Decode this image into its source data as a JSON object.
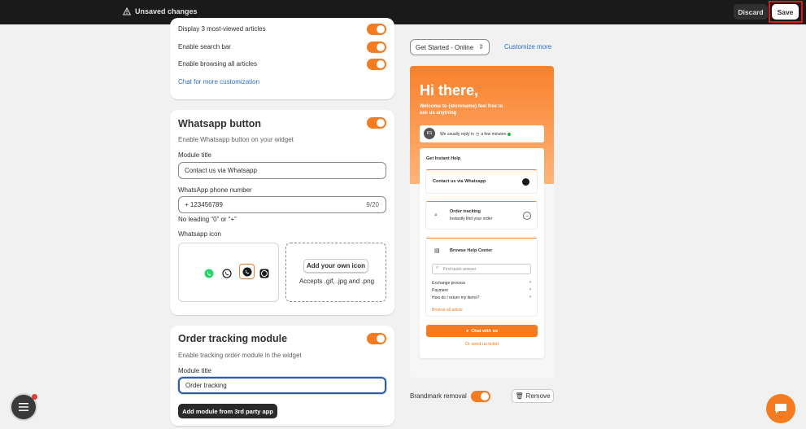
{
  "topbar": {
    "status": "Unsaved changes",
    "discard_label": "Discard",
    "save_label": "Save"
  },
  "colors": {
    "accent": "#f47b1f",
    "link": "#2c6ecb",
    "topbar": "#1a1a1a",
    "highlight": "#d81b1b"
  },
  "card1": {
    "rows": [
      "Display 3 most-viewed articles",
      "Enable search bar",
      "Enable browsing all articles"
    ],
    "link": "Chat for more customization"
  },
  "whatsapp": {
    "title": "Whatsapp button",
    "description": "Enable Whatsapp button on your widget",
    "module_title_label": "Module title",
    "module_title_value": "Contact us via Whatsapp",
    "phone_label": "WhatsApp phone number",
    "phone_value": "+  123456789",
    "phone_counter": "9/20",
    "phone_hint": "No leading “0” or “+”",
    "icon_label": "Whatsapp icon",
    "icons": [
      "whatsapp-green-icon",
      "whatsapp-outline-icon",
      "whatsapp-dark-icon",
      "whatsapp-square-icon"
    ],
    "add_icon_label": "Add your own icon",
    "accepts": "Accepts .gif, .jpg and .png"
  },
  "order": {
    "title": "Order tracking module",
    "description": "Enable tracking order module in the widget",
    "module_title_label": "Module title",
    "module_title_value": "Order tracking",
    "add_module_label": "Add module from 3rd party app"
  },
  "preview": {
    "select_value": "Get Started - Online",
    "customize_link": "Customize more",
    "greeting": "Hi there,",
    "welcome": "Welcome to {storename} feel free to ask us anything",
    "avatar": "KS",
    "reply_text": "We usually reply in",
    "reply_time": "a few minutes",
    "get_help": "Get Instant Help",
    "contact_wa": "Contact us via Whatsapp",
    "order_tracking": "Order tracking",
    "order_sub": "Instantly find your order",
    "browse_help": "Browse Help Center",
    "search_placeholder": "Find quick answer",
    "articles": [
      "Exchange process",
      "Payment",
      "How do I return my items?"
    ],
    "browse_all": "Browse all article",
    "chat_with_us": "Chat with us",
    "send_ticket": "Or send us ticket"
  },
  "footer": {
    "brandmark_label": "Brandmark removal",
    "remove_label": "Remove"
  }
}
